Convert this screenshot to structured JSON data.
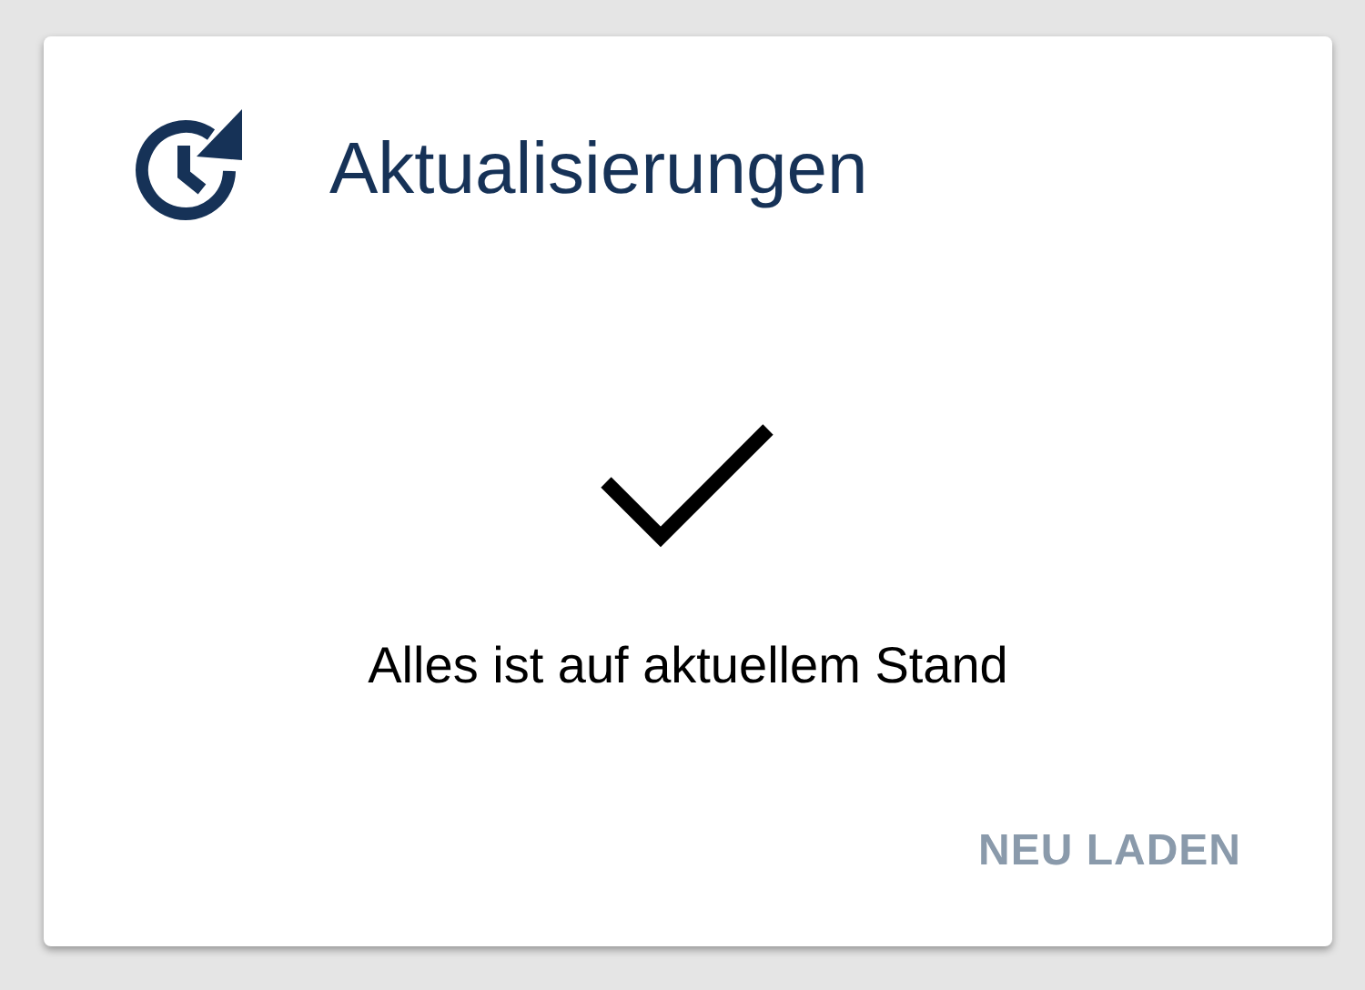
{
  "card": {
    "title": "Aktualisierungen",
    "status": {
      "up_to_date": true,
      "message": "Alles ist auf aktuellem Stand"
    },
    "buttons": [
      {
        "label": "NEU LADEN",
        "disabled": true
      }
    ]
  }
}
